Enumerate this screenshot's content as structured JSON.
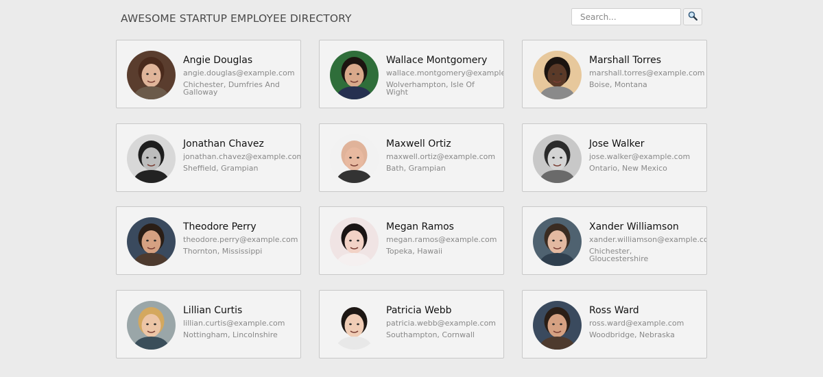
{
  "header": {
    "title": "AWESOME STARTUP EMPLOYEE DIRECTORY"
  },
  "search": {
    "placeholder": "Search...",
    "value": "",
    "button_icon": "magnifier-icon"
  },
  "colors": {
    "background": "#ebebeb",
    "card_background": "#f3f3f3",
    "card_border": "#c8c8c8",
    "name_text": "#111111",
    "detail_text": "#888888"
  },
  "employees": [
    {
      "name": "Angie Douglas",
      "email": "angie.douglas@example.com",
      "location": "Chichester, Dumfries And Galloway",
      "avatar": "woman-brown-hair-photo"
    },
    {
      "name": "Wallace Montgomery",
      "email": "wallace.montgomery@example.com",
      "location": "Wolverhampton, Isle Of Wight",
      "avatar": "man-dark-hair-photo"
    },
    {
      "name": "Marshall Torres",
      "email": "marshall.torres@example.com",
      "location": "Boise, Montana",
      "avatar": "man-glasses-smiling-photo"
    },
    {
      "name": "Jonathan Chavez",
      "email": "jonathan.chavez@example.com",
      "location": "Sheffield, Grampian",
      "avatar": "man-glasses-beard-bw-photo"
    },
    {
      "name": "Maxwell Ortiz",
      "email": "maxwell.ortiz@example.com",
      "location": "Bath, Grampian",
      "avatar": "man-bald-smiling-photo"
    },
    {
      "name": "Jose Walker",
      "email": "jose.walker@example.com",
      "location": "Ontario, New Mexico",
      "avatar": "man-bw-patterned-shirt-photo"
    },
    {
      "name": "Theodore Perry",
      "email": "theodore.perry@example.com",
      "location": "Thornton, Mississippi",
      "avatar": "man-hand-on-face-photo"
    },
    {
      "name": "Megan Ramos",
      "email": "megan.ramos@example.com",
      "location": "Topeka, Hawaii",
      "avatar": "woman-dark-hair-bun-photo"
    },
    {
      "name": "Xander Williamson",
      "email": "xander.williamson@example.com",
      "location": "Chichester, Gloucestershire",
      "avatar": "man-surprised-photo"
    },
    {
      "name": "Lillian Curtis",
      "email": "lillian.curtis@example.com",
      "location": "Nottingham, Lincolnshire",
      "avatar": "woman-blonde-photo"
    },
    {
      "name": "Patricia Webb",
      "email": "patricia.webb@example.com",
      "location": "Southampton, Cornwall",
      "avatar": "woman-short-dark-hair-photo"
    },
    {
      "name": "Ross Ward",
      "email": "ross.ward@example.com",
      "location": "Woodbridge, Nebraska",
      "avatar": "man-hand-on-face-photo"
    }
  ]
}
